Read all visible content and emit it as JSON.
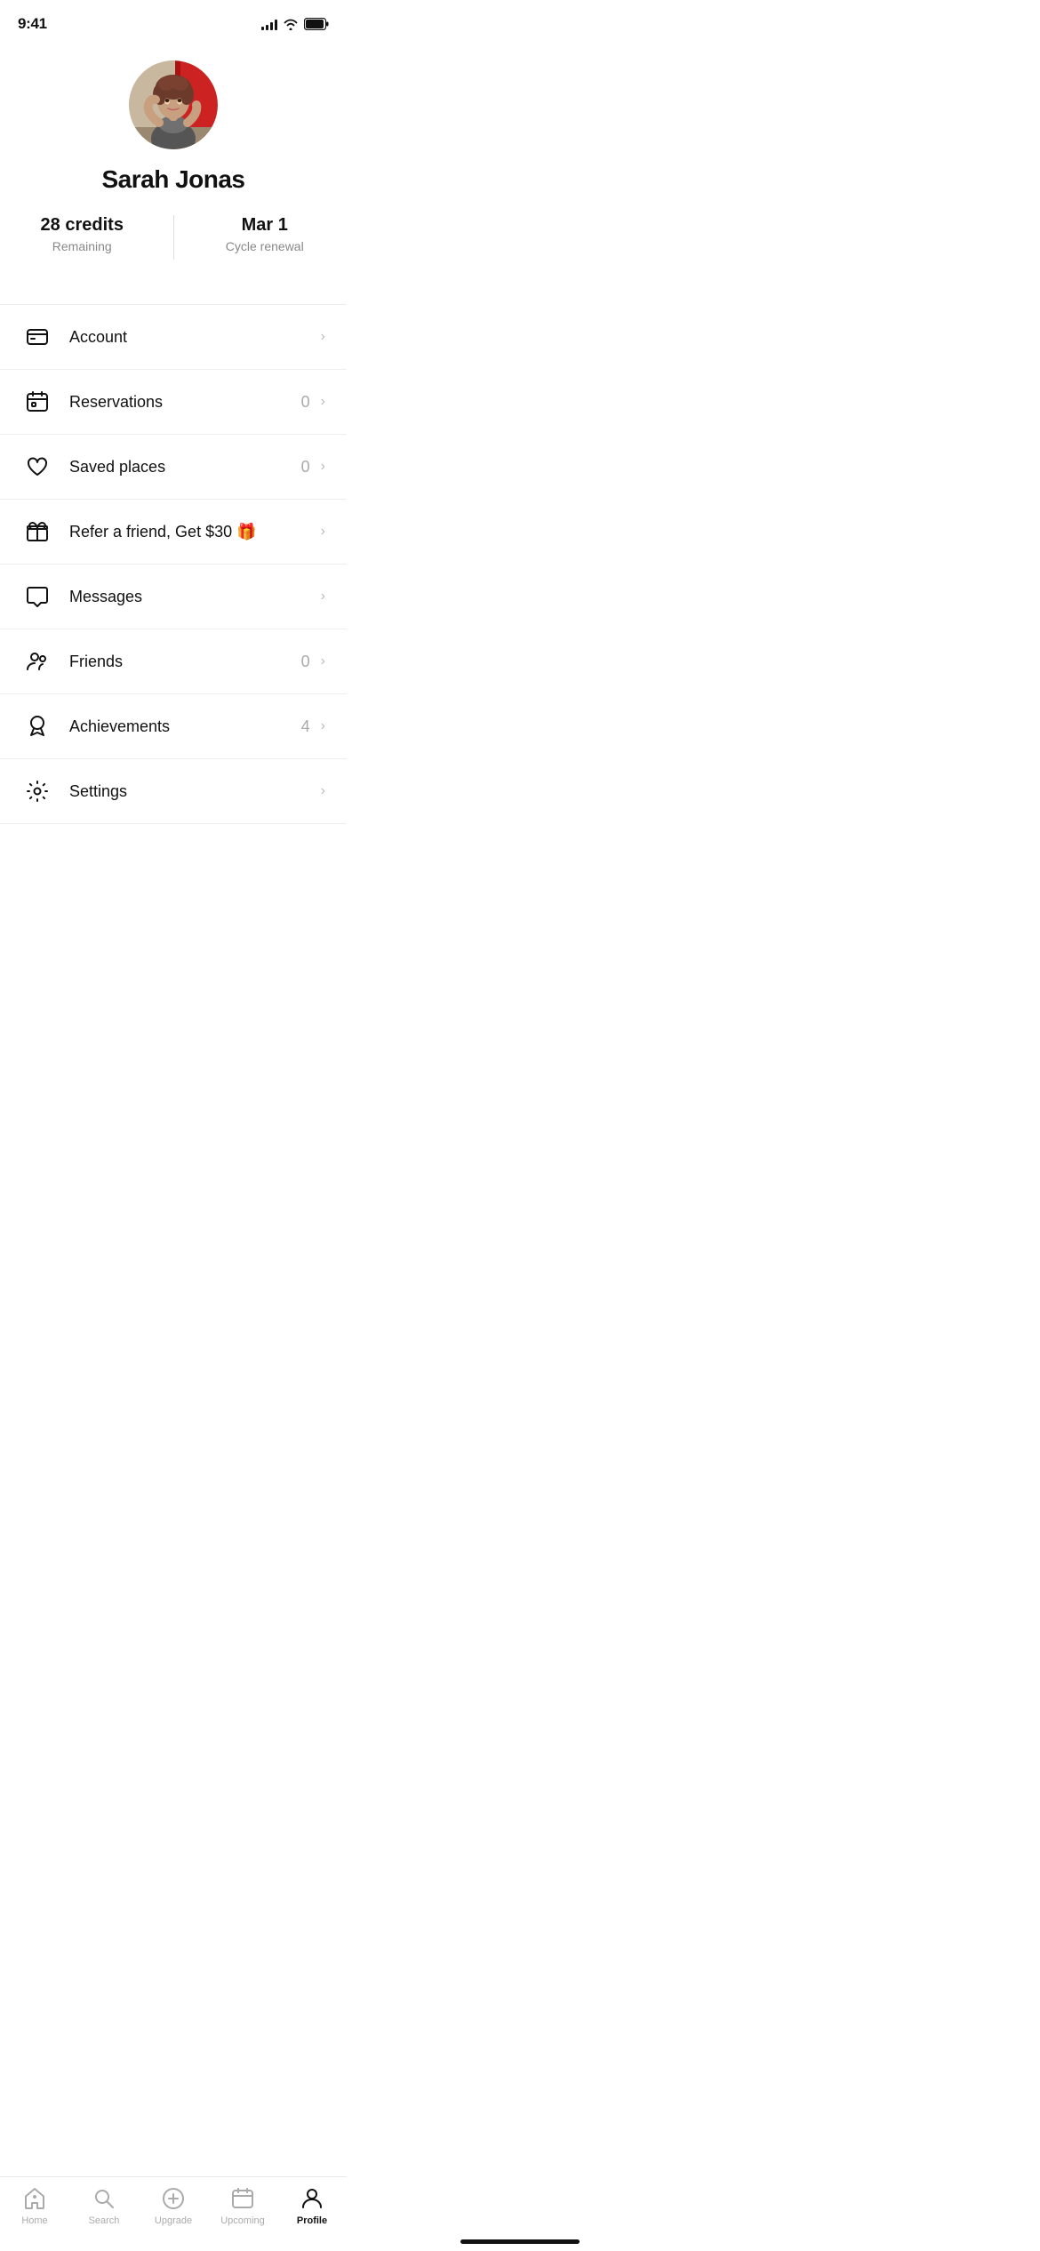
{
  "statusBar": {
    "time": "9:41"
  },
  "profile": {
    "name": "Sarah Jonas",
    "credits": "28 credits",
    "creditsLabel": "Remaining",
    "renewal": "Mar 1",
    "renewalLabel": "Cycle renewal"
  },
  "menuItems": [
    {
      "id": "account",
      "label": "Account",
      "badge": "",
      "icon": "card-icon"
    },
    {
      "id": "reservations",
      "label": "Reservations",
      "badge": "0",
      "icon": "calendar-icon"
    },
    {
      "id": "saved-places",
      "label": "Saved places",
      "badge": "0",
      "icon": "heart-icon"
    },
    {
      "id": "refer",
      "label": "Refer a friend, Get $30 🎁",
      "badge": "",
      "icon": "gift-icon"
    },
    {
      "id": "messages",
      "label": "Messages",
      "badge": "",
      "icon": "chat-icon"
    },
    {
      "id": "friends",
      "label": "Friends",
      "badge": "0",
      "icon": "friends-icon"
    },
    {
      "id": "achievements",
      "label": "Achievements",
      "badge": "4",
      "icon": "achievement-icon"
    },
    {
      "id": "settings",
      "label": "Settings",
      "badge": "",
      "icon": "settings-icon"
    }
  ],
  "tabs": [
    {
      "id": "home",
      "label": "Home",
      "active": false
    },
    {
      "id": "search",
      "label": "Search",
      "active": false
    },
    {
      "id": "upgrade",
      "label": "Upgrade",
      "active": false
    },
    {
      "id": "upcoming",
      "label": "Upcoming",
      "active": false
    },
    {
      "id": "profile",
      "label": "Profile",
      "active": true
    }
  ]
}
